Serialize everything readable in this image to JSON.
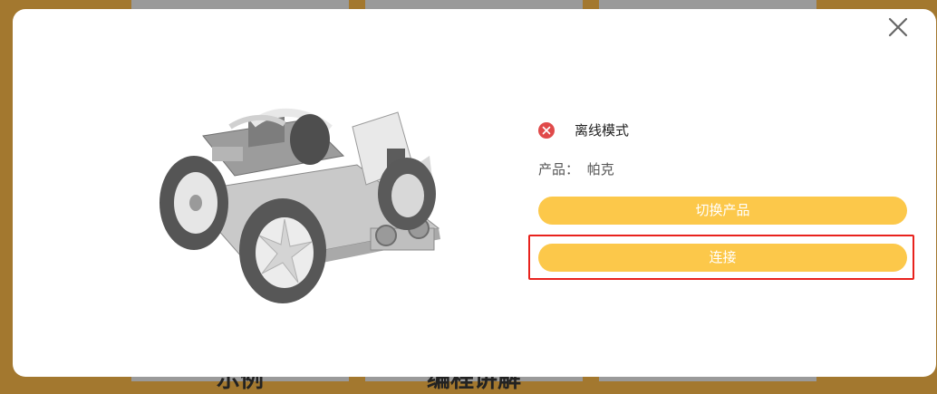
{
  "modal": {
    "status": {
      "icon": "error-circle-icon",
      "text": "离线模式",
      "color": "#e04a4a"
    },
    "product": {
      "label": "产品：",
      "value": "帕克"
    },
    "buttons": {
      "switch_product": "切换产品",
      "connect": "连接"
    },
    "close_icon": "close-icon",
    "accent_color": "#fcc84a",
    "highlight_color": "#e8221d"
  },
  "background": {
    "card_texts": [
      "示例",
      "编程讲解",
      ""
    ]
  }
}
